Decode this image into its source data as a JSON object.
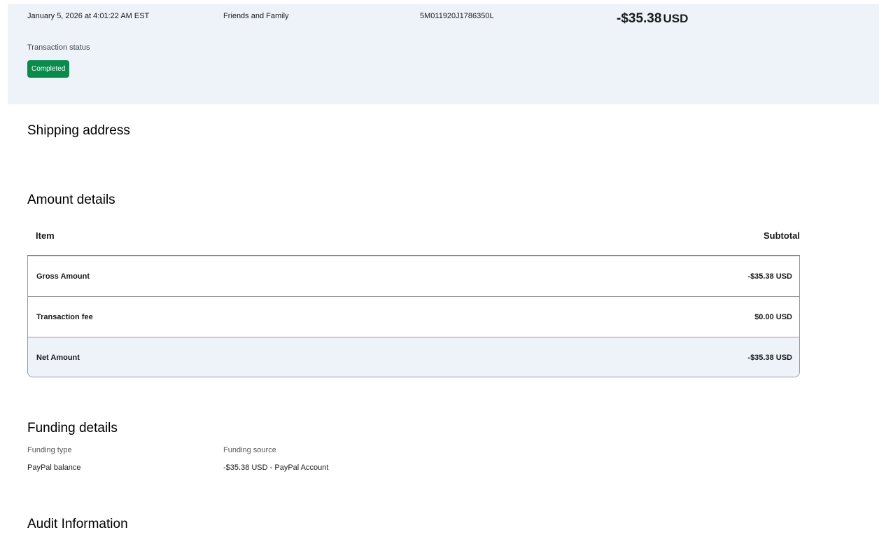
{
  "summary": {
    "date": "January 5, 2026 at 4:01:22 AM EST",
    "type": "Friends and Family",
    "transaction_id": "5M011920J1786350L",
    "amount": "-$35.38",
    "currency": "USD",
    "status_label": "Transaction status",
    "status": "Completed",
    "status_color": "#0a8a4d",
    "band_color": "#eef2f9"
  },
  "shipping": {
    "title": "Shipping address"
  },
  "amount_details": {
    "title": "Amount details",
    "columns": [
      "Item",
      "Subtotal"
    ],
    "rows": [
      {
        "label": "Gross Amount",
        "value": "-$35.38 USD"
      },
      {
        "label": "Transaction fee",
        "value": "$0.00 USD"
      },
      {
        "label": "Net Amount",
        "value": "-$35.38 USD"
      }
    ]
  },
  "funding": {
    "title": "Funding details",
    "type_label": "Funding type",
    "type_value": "PayPal balance",
    "source_label": "Funding source",
    "source_value": "-$35.38 USD - PayPal Account"
  },
  "audit": {
    "title": "Audit Information"
  }
}
